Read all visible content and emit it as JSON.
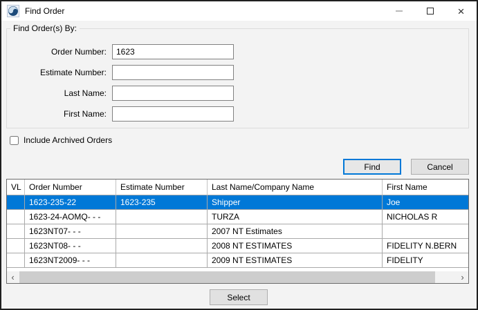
{
  "window": {
    "title": "Find Order"
  },
  "form": {
    "legend": "Find Order(s) By:",
    "fields": [
      {
        "label": "Order Number:",
        "value": "1623"
      },
      {
        "label": "Estimate Number:",
        "value": ""
      },
      {
        "label": "Last Name:",
        "value": ""
      },
      {
        "label": "First Name:",
        "value": ""
      }
    ],
    "archived_checkbox_label": "Include Archived Orders",
    "archived_checked": false
  },
  "buttons": {
    "find": "Find",
    "cancel": "Cancel",
    "select": "Select"
  },
  "table": {
    "columns": [
      "VL",
      "Order Number",
      "Estimate Number",
      "Last Name/Company Name",
      "First Name"
    ],
    "rows": [
      [
        "",
        "1623-235-22",
        "1623-235",
        "Shipper",
        "Joe"
      ],
      [
        "",
        "1623-24-AOMQ- - -",
        "",
        "TURZA",
        "NICHOLAS R"
      ],
      [
        "",
        "1623NT07- - -",
        "",
        "2007 NT Estimates",
        ""
      ],
      [
        "",
        "1623NT08- - -",
        "",
        "2008 NT ESTIMATES",
        "FIDELITY N.BERN"
      ],
      [
        "",
        "1623NT2009- - -",
        "",
        "2009 NT ESTIMATES",
        "FIDELITY"
      ]
    ],
    "selected_row_index": 0
  },
  "colors": {
    "accent": "#0078d7",
    "selected_row_bg": "#0078d7",
    "selected_row_text": "#ffffff",
    "app_icon_blue": "#1b4a7a"
  }
}
